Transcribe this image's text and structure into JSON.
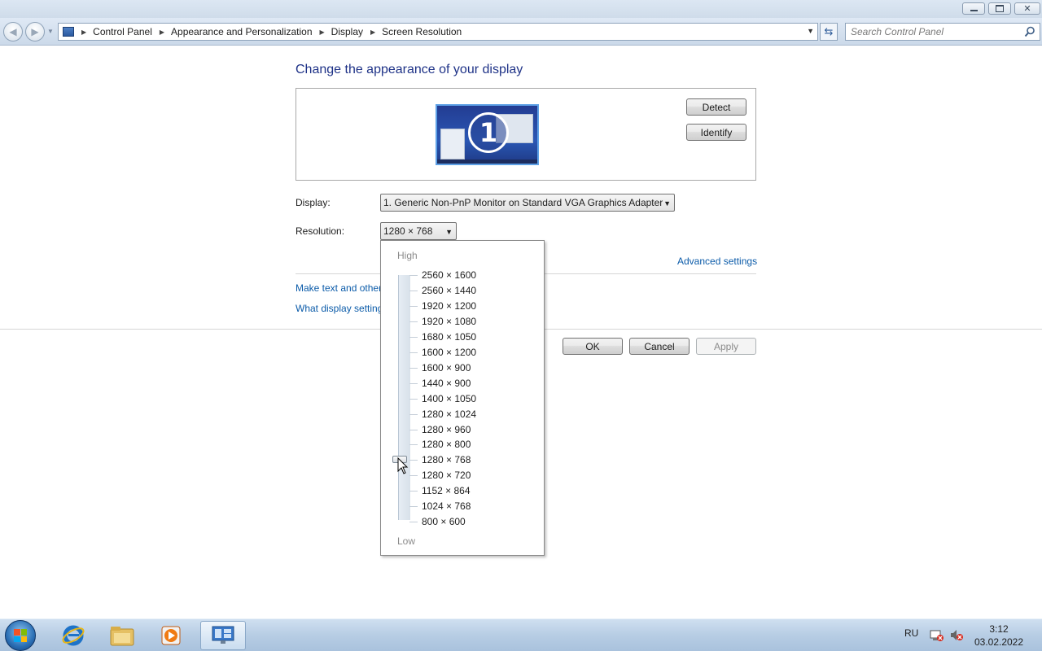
{
  "window": {
    "minimize_icon": "minimize-icon",
    "restore_icon": "restore-icon",
    "close_icon": "close-icon"
  },
  "nav": {
    "breadcrumbs": [
      "Control Panel",
      "Appearance and Personalization",
      "Display",
      "Screen Resolution"
    ],
    "search_placeholder": "Search Control Panel"
  },
  "main": {
    "heading": "Change the appearance of your display",
    "monitor_number": "1",
    "detect_label": "Detect",
    "identify_label": "Identify",
    "display_label": "Display:",
    "display_value": "1. Generic Non-PnP Monitor on Standard VGA Graphics Adapter",
    "resolution_label": "Resolution:",
    "resolution_value": "1280 × 768",
    "advanced_link": "Advanced settings",
    "link_text_size": "Make text and other",
    "link_display_settings": "What display setting",
    "ok_label": "OK",
    "cancel_label": "Cancel",
    "apply_label": "Apply"
  },
  "dropdown": {
    "high_label": "High",
    "low_label": "Low",
    "options": [
      "2560 × 1600",
      "2560 × 1440",
      "1920 × 1200",
      "1920 × 1080",
      "1680 × 1050",
      "1600 × 1200",
      "1600 × 900",
      "1440 × 900",
      "1400 × 1050",
      "1280 × 1024",
      "1280 × 960",
      "1280 × 800",
      "1280 × 768",
      "1280 × 720",
      "1152 × 864",
      "1024 × 768",
      "800 × 600"
    ],
    "selected_index": 12
  },
  "taskbar": {
    "items": [
      "start-button",
      "internet-explorer",
      "file-explorer",
      "media-player",
      "control-panel"
    ],
    "language": "RU",
    "time": "3:12",
    "date": "03.02.2022"
  },
  "colors": {
    "heading": "#1e3287",
    "link": "#0b5ba9",
    "accent": "#2a6fb5"
  }
}
